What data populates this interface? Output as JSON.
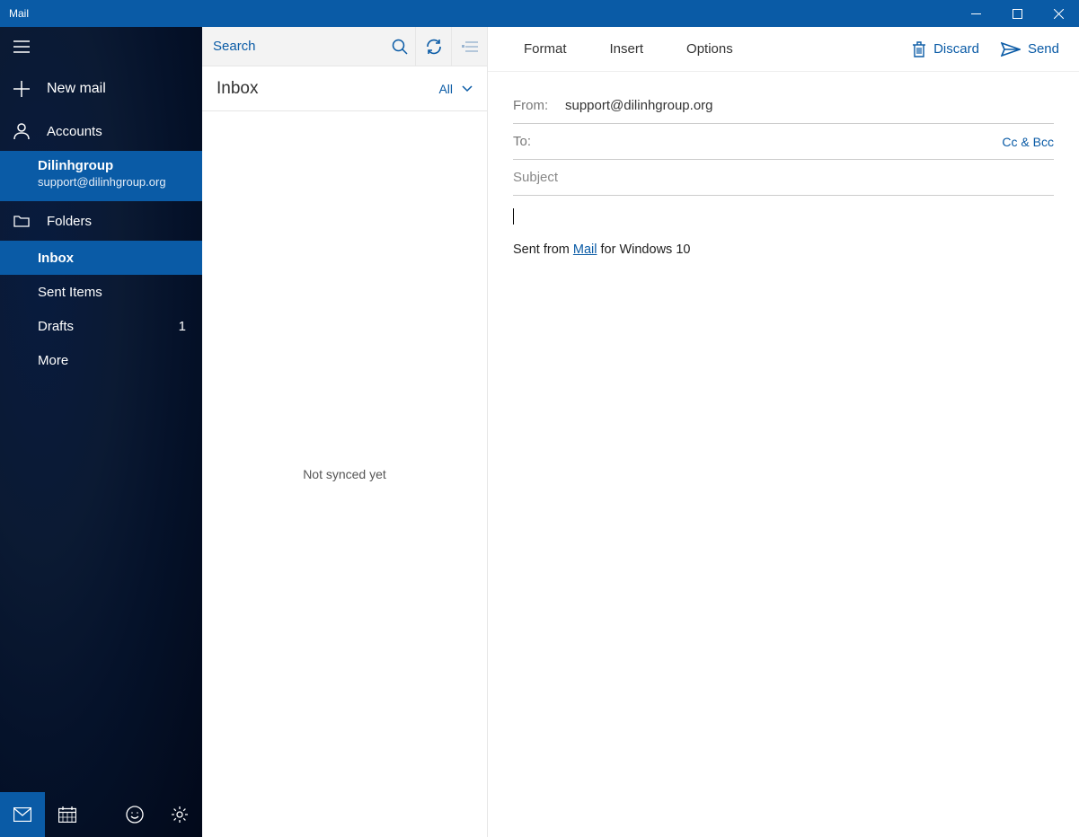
{
  "window": {
    "title": "Mail"
  },
  "sidebar": {
    "new_mail": "New mail",
    "accounts_label": "Accounts",
    "account": {
      "name": "Dilinhgroup",
      "email": "support@dilinhgroup.org"
    },
    "folders_label": "Folders",
    "folders": [
      {
        "label": "Inbox",
        "count": "",
        "active": true
      },
      {
        "label": "Sent Items",
        "count": ""
      },
      {
        "label": "Drafts",
        "count": "1"
      },
      {
        "label": "More",
        "count": ""
      }
    ]
  },
  "list": {
    "search_placeholder": "Search",
    "title": "Inbox",
    "filter_label": "All",
    "empty_text": "Not synced yet"
  },
  "compose": {
    "tabs": {
      "format": "Format",
      "insert": "Insert",
      "options": "Options"
    },
    "actions": {
      "discard": "Discard",
      "send": "Send"
    },
    "from_label": "From:",
    "from_value": "support@dilinhgroup.org",
    "to_label": "To:",
    "ccbcc": "Cc & Bcc",
    "subject_placeholder": "Subject",
    "signature_pre": "Sent from ",
    "signature_link": "Mail",
    "signature_post": " for Windows 10"
  }
}
